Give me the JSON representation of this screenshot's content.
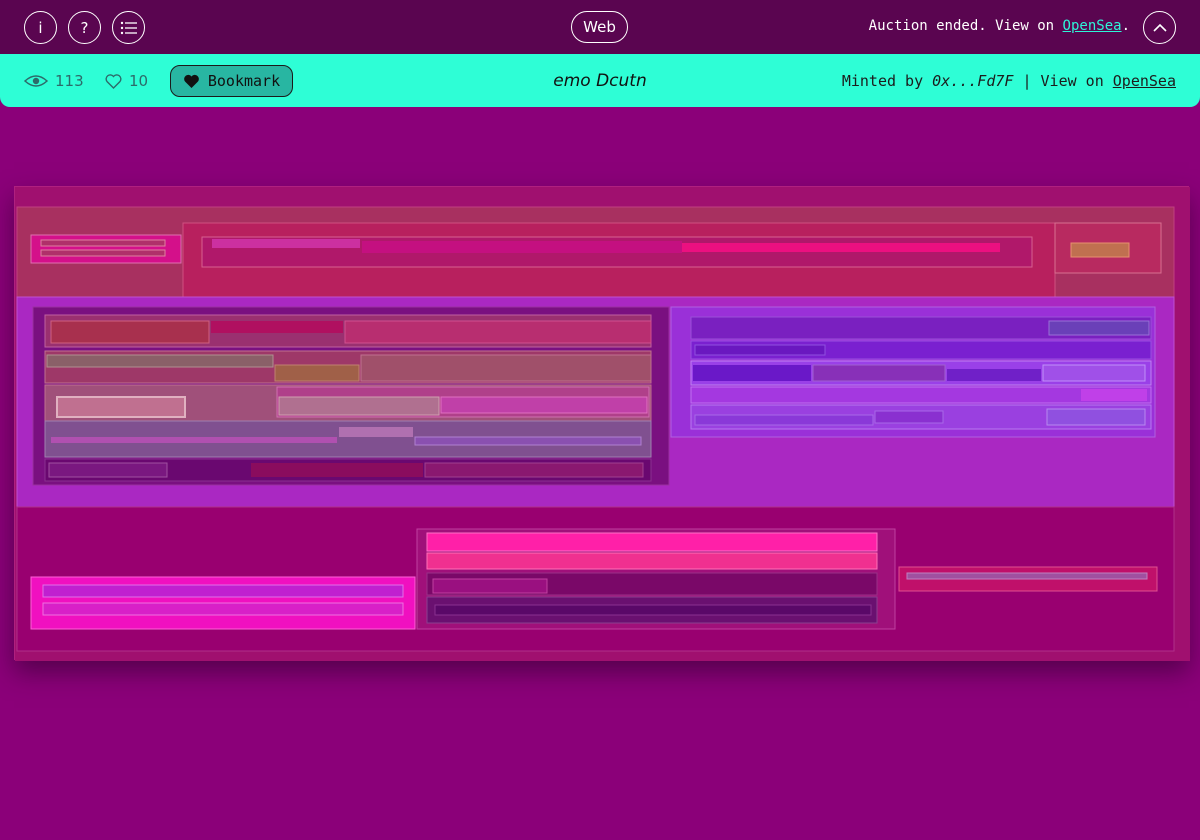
{
  "topbar": {
    "info_icon": "i",
    "help_icon": "?",
    "menu_icon": "list-icon",
    "web_label": "Web",
    "auction_text": "Auction ended. View on ",
    "auction_link": "OpenSea",
    "auction_suffix": ".",
    "collapse_icon": "chevron-up-icon"
  },
  "infobar": {
    "views": "113",
    "likes": "10",
    "bookmark_label": "Bookmark",
    "title": "emo Dcutn",
    "minted_prefix": "Minted by ",
    "minted_address": "0x...Fd7F",
    "view_prefix": " | View on ",
    "view_link": "OpenSea"
  },
  "colors": {
    "page_bg": "#8b0079",
    "topbar_bg": "#5a0550",
    "accent": "#2efed6",
    "link": "#2ef5d8"
  }
}
